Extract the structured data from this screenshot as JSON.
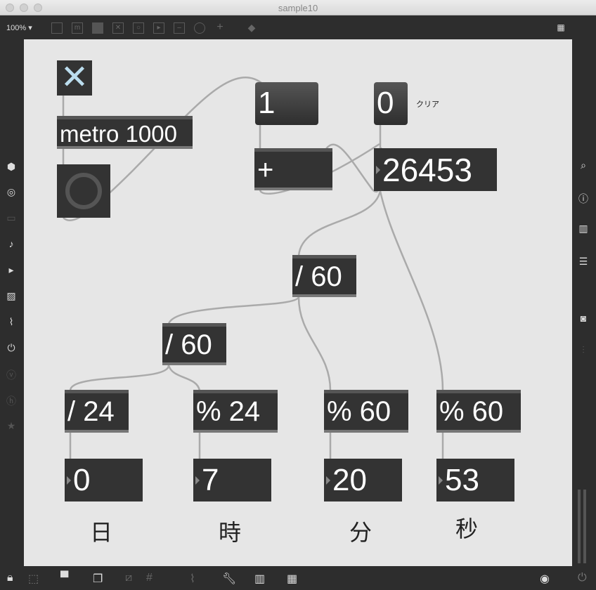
{
  "window": {
    "title": "sample10"
  },
  "toolbar": {
    "zoom": "100%"
  },
  "patch": {
    "metro": "metro 1000",
    "msg_one": "1",
    "msg_zero": "0",
    "clear_comment": "クリア",
    "plus": "+",
    "counter": "26453",
    "div60a": "/ 60",
    "div60b": "/ 60",
    "div24": "/ 24",
    "mod24": "% 24",
    "mod60a": "% 60",
    "mod60b": "% 60",
    "days": "0",
    "hours": "7",
    "minutes": "20",
    "seconds": "53",
    "label_days": "日",
    "label_hours": "時",
    "label_minutes": "分",
    "label_seconds": "秒"
  }
}
